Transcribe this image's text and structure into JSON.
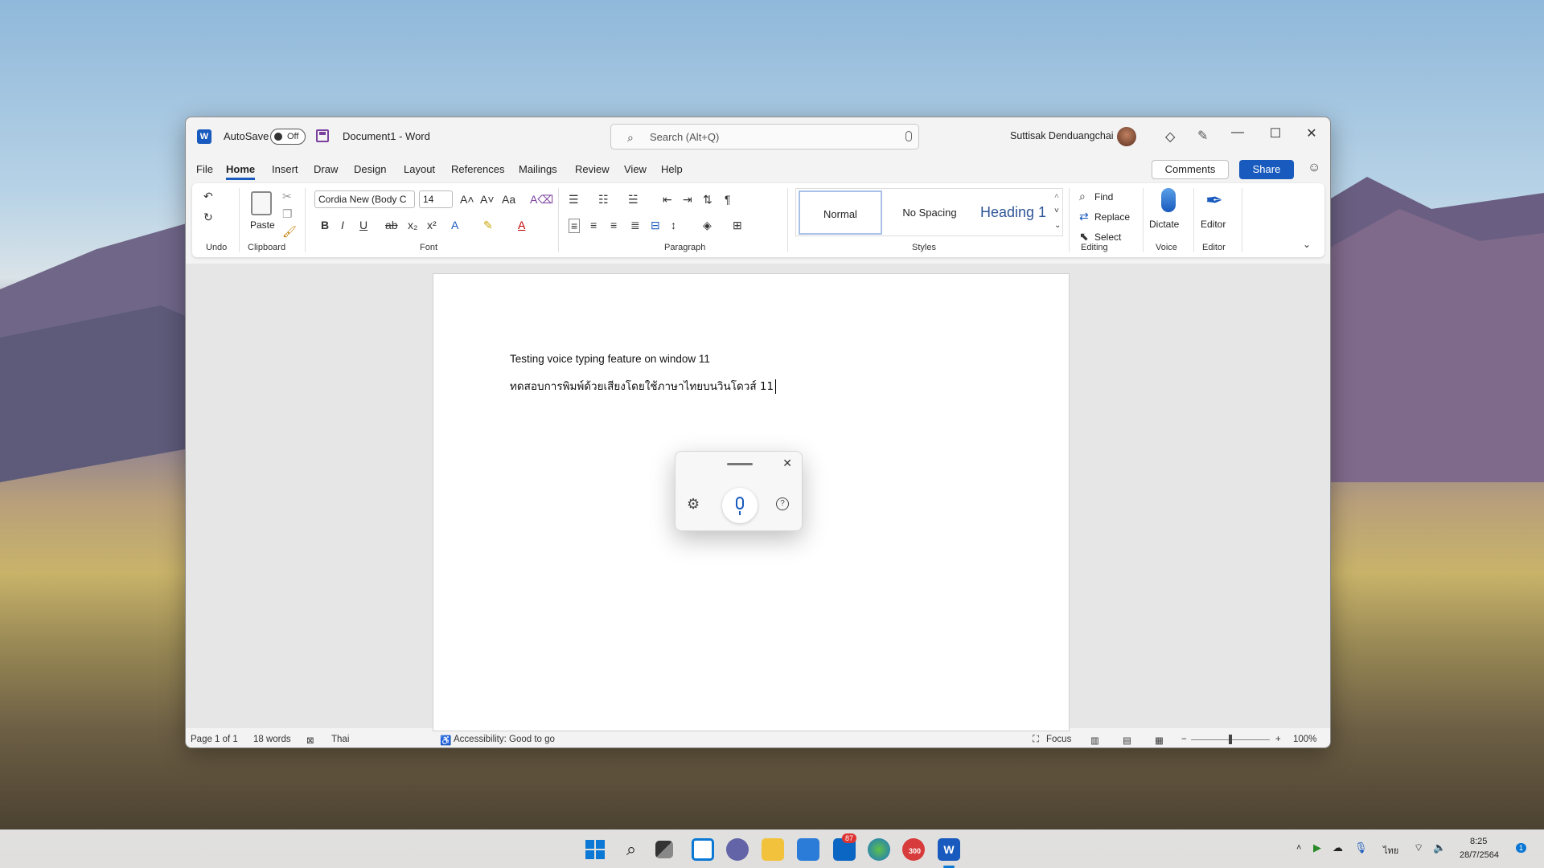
{
  "window": {
    "autosave_label": "AutoSave",
    "autosave_state": "Off",
    "doc_title": "Document1  -  Word",
    "search_placeholder": "Search (Alt+Q)",
    "user_name": "Suttisak Denduangchai",
    "minimize": "—",
    "maximize": "☐",
    "close": "✕"
  },
  "menu": {
    "items": [
      "File",
      "Home",
      "Insert",
      "Draw",
      "Design",
      "Layout",
      "References",
      "Mailings",
      "Review",
      "View",
      "Help"
    ],
    "comments": "Comments",
    "share": "Share"
  },
  "ribbon": {
    "groups": {
      "undo": "Undo",
      "clipboard": "Clipboard",
      "font": "Font",
      "paragraph": "Paragraph",
      "styles": "Styles",
      "editing": "Editing",
      "voice": "Voice",
      "editor": "Editor"
    },
    "paste": "Paste",
    "font_name": "Cordia New (Body C",
    "font_size": "14",
    "styles_list": [
      "Normal",
      "No Spacing",
      "Heading 1"
    ],
    "find": "Find",
    "replace": "Replace",
    "select": "Select",
    "dictate": "Dictate",
    "editor_btn": "Editor"
  },
  "document": {
    "line1": "Testing voice typing feature on window 11",
    "line2": "ทดสอบการพิมพ์ด้วยเสียงโดยใช้ภาษาไทยบนวินโดวส์ 11"
  },
  "status": {
    "page": "Page 1 of 1",
    "words": "18 words",
    "language": "Thai",
    "accessibility": "Accessibility: Good to go",
    "focus": "Focus",
    "zoom": "100%"
  },
  "taskbar": {
    "store_badge": "87",
    "time": "8:25",
    "date": "28/7/2564",
    "ime": "ไทย",
    "notif": "1",
    "app_badge": "300"
  },
  "colors": {
    "word_blue": "#185abd",
    "ribbon_bg": "#ffffff",
    "chrome_bg": "#f3f3f3"
  }
}
